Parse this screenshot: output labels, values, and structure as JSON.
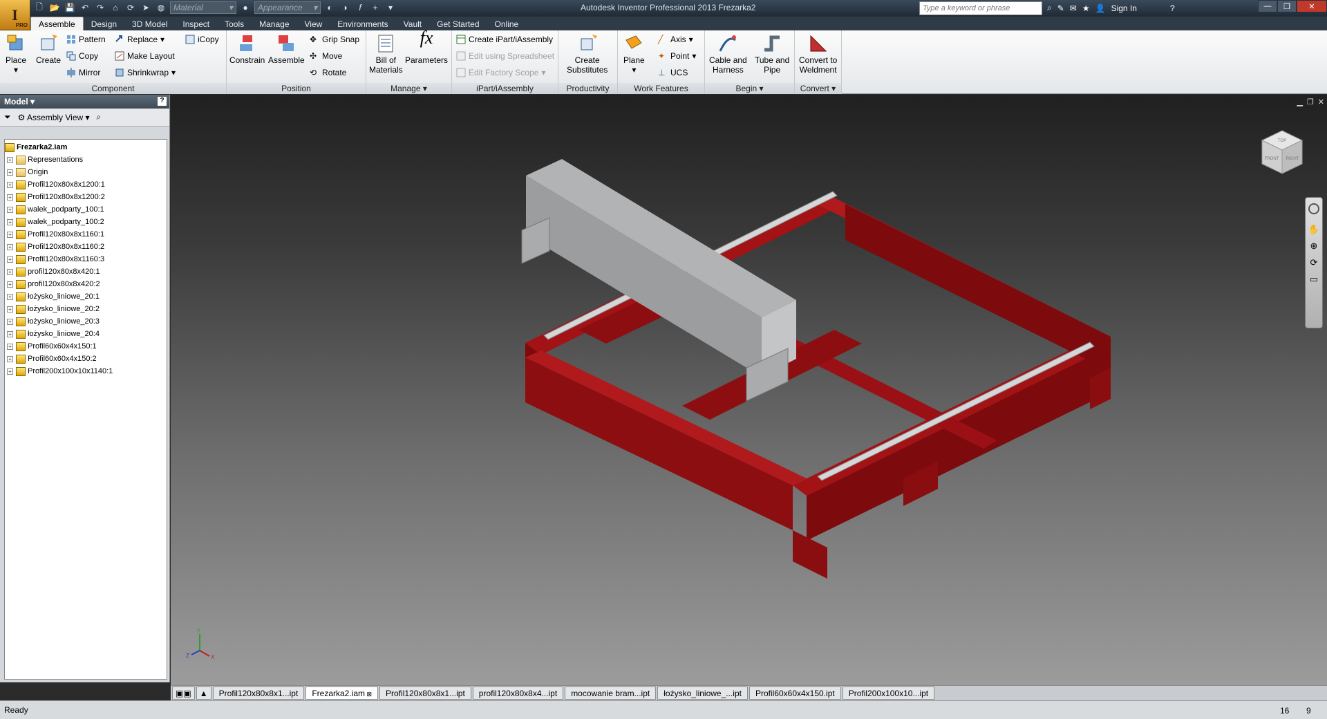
{
  "app": {
    "title": "Autodesk Inventor Professional 2013    Frezarka2",
    "pro_label": "PRO",
    "material_placeholder": "Material",
    "appearance_placeholder": "Appearance",
    "search_placeholder": "Type a keyword or phrase",
    "sign_in": "Sign In"
  },
  "tabs": [
    "Assemble",
    "Design",
    "3D Model",
    "Inspect",
    "Tools",
    "Manage",
    "View",
    "Environments",
    "Vault",
    "Get Started",
    "Online"
  ],
  "ribbon": {
    "component": {
      "title": "Component",
      "place": "Place",
      "create": "Create",
      "pattern": "Pattern",
      "copy": "Copy",
      "mirror": "Mirror",
      "replace": "Replace",
      "make_layout": "Make Layout",
      "shrinkwrap": "Shrinkwrap",
      "icopy": "iCopy"
    },
    "position": {
      "title": "Position",
      "constrain": "Constrain",
      "assemble": "Assemble",
      "grip_snap": "Grip Snap",
      "move": "Move",
      "rotate": "Rotate"
    },
    "manage": {
      "title": "Manage",
      "bom_line1": "Bill of",
      "bom_line2": "Materials",
      "parameters": "Parameters"
    },
    "ipart": {
      "title": "iPart/iAssembly",
      "create": "Create iPart/iAssembly",
      "edit_spreadsheet": "Edit using Spreadsheet",
      "edit_factory": "Edit Factory Scope"
    },
    "productivity": {
      "title": "Productivity",
      "create_line1": "Create",
      "create_line2": "Substitutes"
    },
    "work_features": {
      "title": "Work Features",
      "plane": "Plane",
      "axis": "Axis",
      "point": "Point",
      "ucs": "UCS"
    },
    "begin": {
      "title": "Begin",
      "cable_line1": "Cable and",
      "cable_line2": "Harness",
      "tube_line1": "Tube and",
      "tube_line2": "Pipe"
    },
    "convert": {
      "title": "Convert",
      "weld_line1": "Convert to",
      "weld_line2": "Weldment"
    }
  },
  "browser": {
    "title": "Model",
    "view": "Assembly View",
    "root": "Frezarka2.iam",
    "items": [
      {
        "label": "Representations",
        "type": "folder"
      },
      {
        "label": "Origin",
        "type": "folder"
      },
      {
        "label": "Profil120x80x8x1200:1",
        "type": "part"
      },
      {
        "label": "Profil120x80x8x1200:2",
        "type": "part"
      },
      {
        "label": "walek_podparty_100:1",
        "type": "part"
      },
      {
        "label": "walek_podparty_100:2",
        "type": "part"
      },
      {
        "label": "Profil120x80x8x1160:1",
        "type": "part"
      },
      {
        "label": "Profil120x80x8x1160:2",
        "type": "part"
      },
      {
        "label": "Profil120x80x8x1160:3",
        "type": "part"
      },
      {
        "label": "profil120x80x8x420:1",
        "type": "part"
      },
      {
        "label": "profil120x80x8x420:2",
        "type": "part"
      },
      {
        "label": "łożysko_liniowe_20:1",
        "type": "part"
      },
      {
        "label": "łożysko_liniowe_20:2",
        "type": "part"
      },
      {
        "label": "łożysko_liniowe_20:3",
        "type": "part"
      },
      {
        "label": "łożysko_liniowe_20:4",
        "type": "part"
      },
      {
        "label": "Profil60x60x4x150:1",
        "type": "part"
      },
      {
        "label": "Profil60x60x4x150:2",
        "type": "part"
      },
      {
        "label": "Profil200x100x10x1140:1",
        "type": "part"
      }
    ]
  },
  "doc_tabs": [
    {
      "label": "Profil120x80x8x1...ipt",
      "active": false
    },
    {
      "label": "Frezarka2.iam",
      "active": true
    },
    {
      "label": "Profil120x80x8x1...ipt",
      "active": false
    },
    {
      "label": "profil120x80x8x4...ipt",
      "active": false
    },
    {
      "label": "mocowanie bram...ipt",
      "active": false
    },
    {
      "label": "łożysko_liniowe_...ipt",
      "active": false
    },
    {
      "label": "Profil60x60x4x150.ipt",
      "active": false
    },
    {
      "label": "Profil200x100x10...ipt",
      "active": false
    }
  ],
  "status": {
    "text": "Ready",
    "num1": "16",
    "num2": "9"
  },
  "viewcube": {
    "front": "FRONT",
    "right": "RIGHT",
    "top": "TOP"
  },
  "axes": {
    "x": "X",
    "y": "Y",
    "z": "Z"
  },
  "colors": {
    "frame": "#9b0f12",
    "gantry": "#a8a8aa",
    "rail": "#cfd2d4"
  }
}
